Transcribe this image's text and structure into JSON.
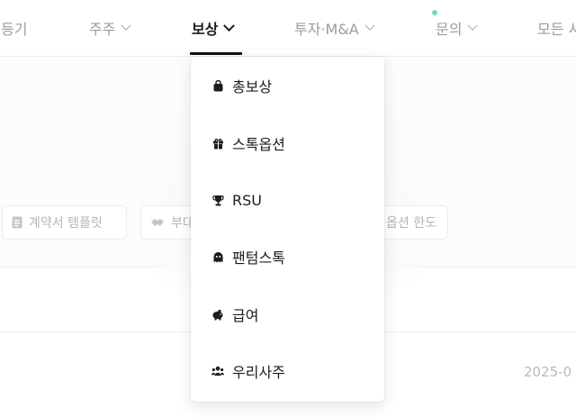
{
  "nav": {
    "items": [
      {
        "label": "·등기"
      },
      {
        "label": "주주"
      },
      {
        "label": "보상"
      },
      {
        "label": "투자·M&A"
      },
      {
        "label": "문의"
      },
      {
        "label": "모든 서"
      }
    ]
  },
  "background": {
    "chips": [
      {
        "label": "계약서 템플릿",
        "icon": "document-icon"
      },
      {
        "label": "부대",
        "icon": "handshake-icon"
      },
      {
        "label": "옵션 한도",
        "icon": ""
      }
    ],
    "date": "2025-0"
  },
  "dropdown": {
    "items": [
      {
        "label": "총보상",
        "icon": "bag-icon"
      },
      {
        "label": "스톡옵션",
        "icon": "gift-icon"
      },
      {
        "label": "RSU",
        "icon": "trophy-icon"
      },
      {
        "label": "팬텀스톡",
        "icon": "ghost-icon"
      },
      {
        "label": "급여",
        "icon": "piggy-bank-icon"
      },
      {
        "label": "우리사주",
        "icon": "users-icon"
      }
    ]
  },
  "colors": {
    "active": "#1b1c1f",
    "inactive": "#9a9ca1",
    "status_dot": "#7fd0b9"
  }
}
